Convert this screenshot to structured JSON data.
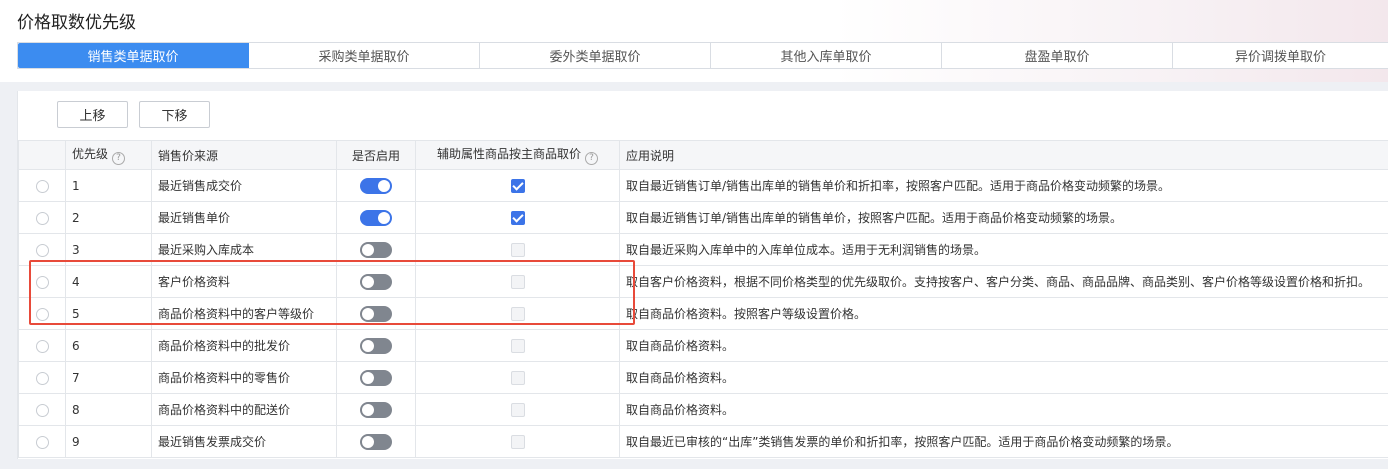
{
  "page_title": "价格取数优先级",
  "tabs": [
    {
      "label": "销售类单据取价",
      "active": true
    },
    {
      "label": "采购类单据取价",
      "active": false
    },
    {
      "label": "委外类单据取价",
      "active": false
    },
    {
      "label": "其他入库单取价",
      "active": false
    },
    {
      "label": "盘盈单取价",
      "active": false
    },
    {
      "label": "异价调拨单取价",
      "active": false
    }
  ],
  "toolbar": {
    "up_label": "上移",
    "down_label": "下移"
  },
  "help_glyph": "?",
  "table": {
    "headers": {
      "priority": "优先级",
      "source": "销售价来源",
      "enabled": "是否启用",
      "aux": "辅助属性商品按主商品取价",
      "desc": "应用说明"
    },
    "rows": [
      {
        "priority": "1",
        "source": "最近销售成交价",
        "enabled": true,
        "aux": true,
        "desc": "取自最近销售订单/销售出库单的销售单价和折扣率，按照客户匹配。适用于商品价格变动频繁的场景。"
      },
      {
        "priority": "2",
        "source": "最近销售单价",
        "enabled": true,
        "aux": true,
        "desc": "取自最近销售订单/销售出库单的销售单价，按照客户匹配。适用于商品价格变动频繁的场景。"
      },
      {
        "priority": "3",
        "source": "最近采购入库成本",
        "enabled": false,
        "aux": false,
        "desc": "取自最近采购入库单中的入库单位成本。适用于无利润销售的场景。"
      },
      {
        "priority": "4",
        "source": "客户价格资料",
        "enabled": false,
        "aux": false,
        "desc": "取自客户价格资料，根据不同价格类型的优先级取价。支持按客户、客户分类、商品、商品品牌、商品类别、客户价格等级设置价格和折扣。"
      },
      {
        "priority": "5",
        "source": "商品价格资料中的客户等级价",
        "enabled": false,
        "aux": false,
        "desc": "取自商品价格资料。按照客户等级设置价格。"
      },
      {
        "priority": "6",
        "source": "商品价格资料中的批发价",
        "enabled": false,
        "aux": false,
        "desc": "取自商品价格资料。"
      },
      {
        "priority": "7",
        "source": "商品价格资料中的零售价",
        "enabled": false,
        "aux": false,
        "desc": "取自商品价格资料。"
      },
      {
        "priority": "8",
        "source": "商品价格资料中的配送价",
        "enabled": false,
        "aux": false,
        "desc": "取自商品价格资料。"
      },
      {
        "priority": "9",
        "source": "最近销售发票成交价",
        "enabled": false,
        "aux": false,
        "desc": "取自最近已审核的“出库”类销售发票的单价和折扣率，按照客户匹配。适用于商品价格变动频繁的场景。"
      }
    ]
  },
  "colors": {
    "accent": "#3c8cf0",
    "toggle_on": "#3c74e8",
    "toggle_off": "#80868f",
    "highlight": "#e84a3a"
  }
}
